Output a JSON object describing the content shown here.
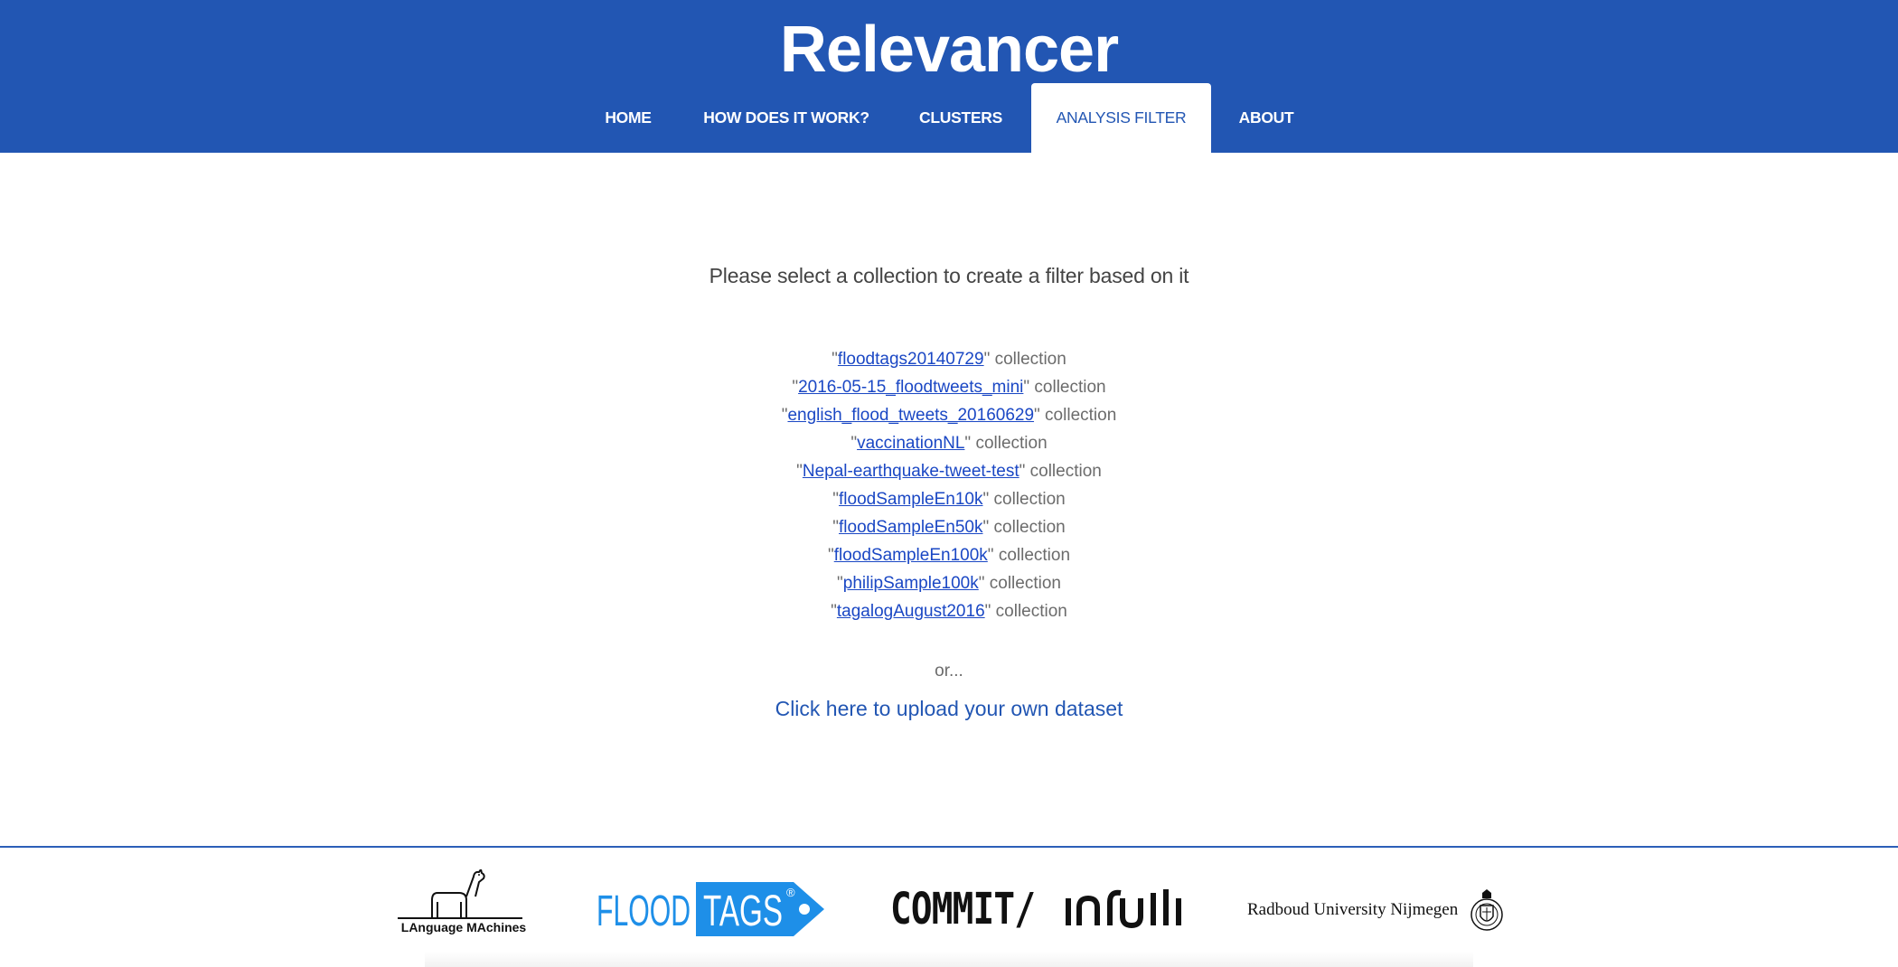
{
  "header": {
    "app_title": "Relevancer",
    "nav": [
      {
        "label": "HOME",
        "active": false
      },
      {
        "label": "HOW DOES IT WORK?",
        "active": false
      },
      {
        "label": "CLUSTERS",
        "active": false
      },
      {
        "label": "ANALYSIS FILTER",
        "active": true
      },
      {
        "label": "ABOUT",
        "active": false
      }
    ]
  },
  "main": {
    "prompt": "Please select a collection to create a filter based on it",
    "quote": "\"",
    "suffix": "\" collection",
    "collections": [
      "floodtags20140729",
      "2016-05-15_floodtweets_mini",
      "english_flood_tweets_20160629",
      "vaccinationNL",
      "Nepal-earthquake-tweet-test",
      "floodSampleEn10k",
      "floodSampleEn50k",
      "floodSampleEn100k",
      "philipSample100k",
      "tagalogAugust2016"
    ],
    "or_text": "or...",
    "upload_link": "Click here to upload your own dataset"
  },
  "footer": {
    "logos": {
      "language_machines": "LAnguage MAchines",
      "floodtags_left": "FLOOD",
      "floodtags_right": "TAGS",
      "floodtags_mark": "®",
      "commit": "COMMIT/",
      "radboud": "Radboud University Nijmegen"
    }
  },
  "colors": {
    "brand_blue": "#2256b3",
    "link_blue": "#1a47c4",
    "floodtags_blue": "#1e8fe8",
    "muted_text": "#6b6b6b"
  }
}
